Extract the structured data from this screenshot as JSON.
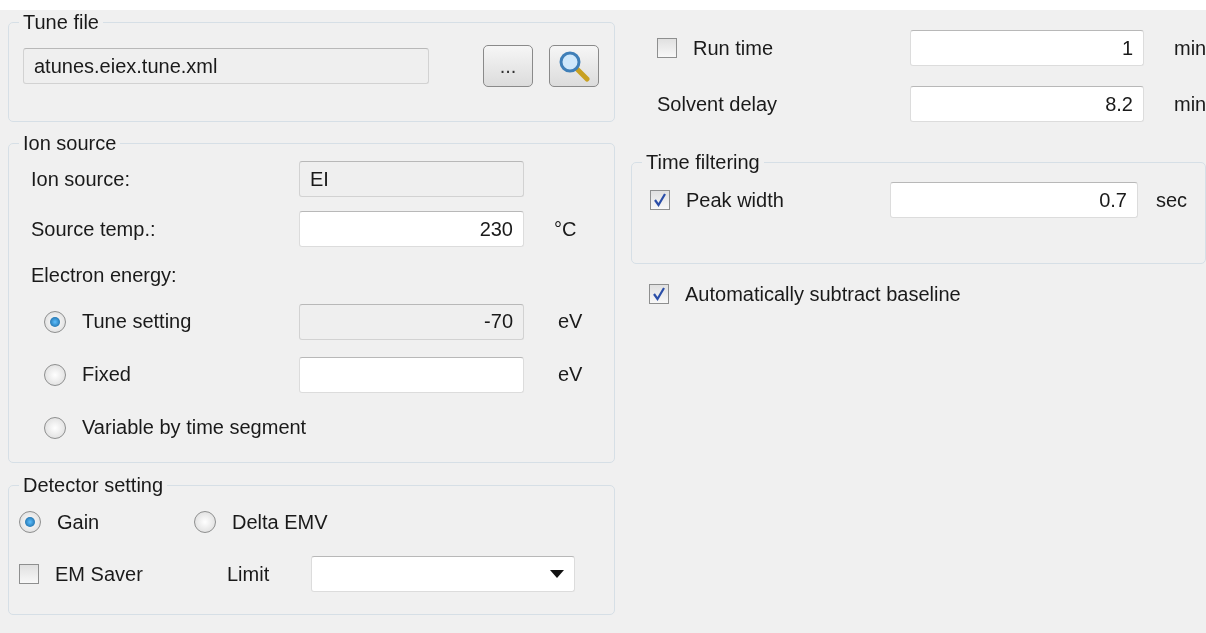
{
  "tune_file": {
    "title": "Tune file",
    "file_name": "atunes.eiex.tune.xml",
    "browse_label": "..."
  },
  "ion_source": {
    "title": "Ion source",
    "source_label": "Ion source:",
    "source_value": "EI",
    "temp_label": "Source temp.:",
    "temp_value": "230",
    "temp_unit": "°C",
    "energy_label": "Electron energy:",
    "energy_options": [
      {
        "label": "Tune setting",
        "selected": true,
        "kind": "field",
        "value": "-70",
        "unit": "eV",
        "disabled": true
      },
      {
        "label": "Fixed",
        "selected": false,
        "kind": "field",
        "unit": "eV",
        "disabled": false
      },
      {
        "label": "Variable by time segment",
        "selected": false,
        "kind": "plain"
      }
    ]
  },
  "detector": {
    "title": "Detector setting",
    "modes": [
      {
        "label": "Gain",
        "selected": true
      },
      {
        "label": "Delta EMV",
        "selected": false
      }
    ],
    "em_saver": {
      "label": "EM Saver",
      "checked": false
    },
    "limit_label": "Limit"
  },
  "run_time": {
    "label": "Run time",
    "checked": false,
    "value": "1",
    "unit": "min"
  },
  "solvent_delay": {
    "label": "Solvent delay",
    "value": "8.2",
    "unit": "min"
  },
  "time_filtering": {
    "title": "Time filtering",
    "peak_width": {
      "label": "Peak width",
      "checked": true,
      "value": "0.7",
      "unit": "sec"
    }
  },
  "auto_subtract": {
    "label": "Automatically subtract baseline",
    "checked": true
  }
}
